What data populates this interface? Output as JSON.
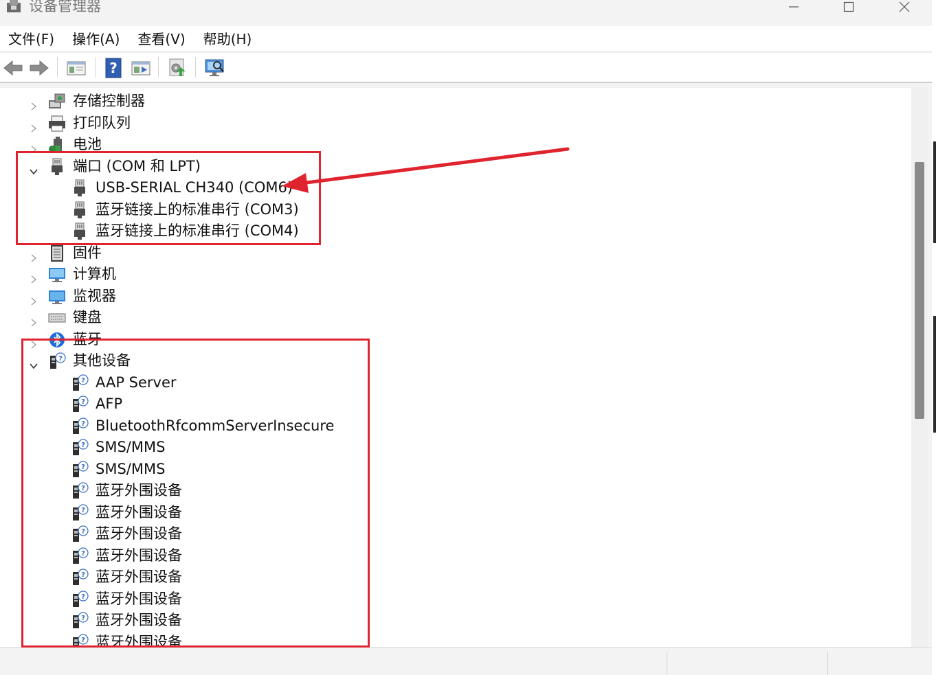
{
  "window": {
    "title": "设备管理器",
    "minimize_icon": "minimize-icon",
    "maximize_icon": "maximize-icon",
    "close_icon": "close-icon"
  },
  "menu": [
    "文件(F)",
    "操作(A)",
    "查看(V)",
    "帮助(H)"
  ],
  "toolbar": {
    "buttons": [
      "back-arrow-icon",
      "forward-arrow-icon",
      "properties-view-icon",
      "help-icon",
      "action-view-icon",
      "update-driver-icon",
      "scan-hardware-icon"
    ]
  },
  "tree": {
    "categories": [
      {
        "label": "存储控制器",
        "icon": "storage-controller-icon",
        "expanded": false
      },
      {
        "label": "打印队列",
        "icon": "printer-icon",
        "expanded": false
      },
      {
        "label": "电池",
        "icon": "battery-icon",
        "expanded": false
      },
      {
        "label": "端口 (COM 和 LPT)",
        "icon": "port-icon",
        "expanded": true,
        "children": [
          "USB-SERIAL CH340 (COM6)",
          "蓝牙链接上的标准串行 (COM3)",
          "蓝牙链接上的标准串行 (COM4)"
        ]
      },
      {
        "label": "固件",
        "icon": "firmware-icon",
        "expanded": false
      },
      {
        "label": "计算机",
        "icon": "computer-icon",
        "expanded": false
      },
      {
        "label": "监视器",
        "icon": "monitor-icon",
        "expanded": false
      },
      {
        "label": "键盘",
        "icon": "keyboard-icon",
        "expanded": false
      },
      {
        "label": "蓝牙",
        "icon": "bluetooth-icon",
        "expanded": false
      },
      {
        "label": "其他设备",
        "icon": "unknown-device-icon",
        "expanded": true,
        "children": [
          "AAP Server",
          "AFP",
          "BluetoothRfcommServerInsecure",
          "SMS/MMS",
          "SMS/MMS",
          "蓝牙外围设备",
          "蓝牙外围设备",
          "蓝牙外围设备",
          "蓝牙外围设备",
          "蓝牙外围设备",
          "蓝牙外围设备",
          "蓝牙外围设备",
          "蓝牙外围设备"
        ]
      }
    ]
  },
  "colors": {
    "annotation_red": "#e0242f",
    "scroll_thumb": "#8a8a8a"
  }
}
